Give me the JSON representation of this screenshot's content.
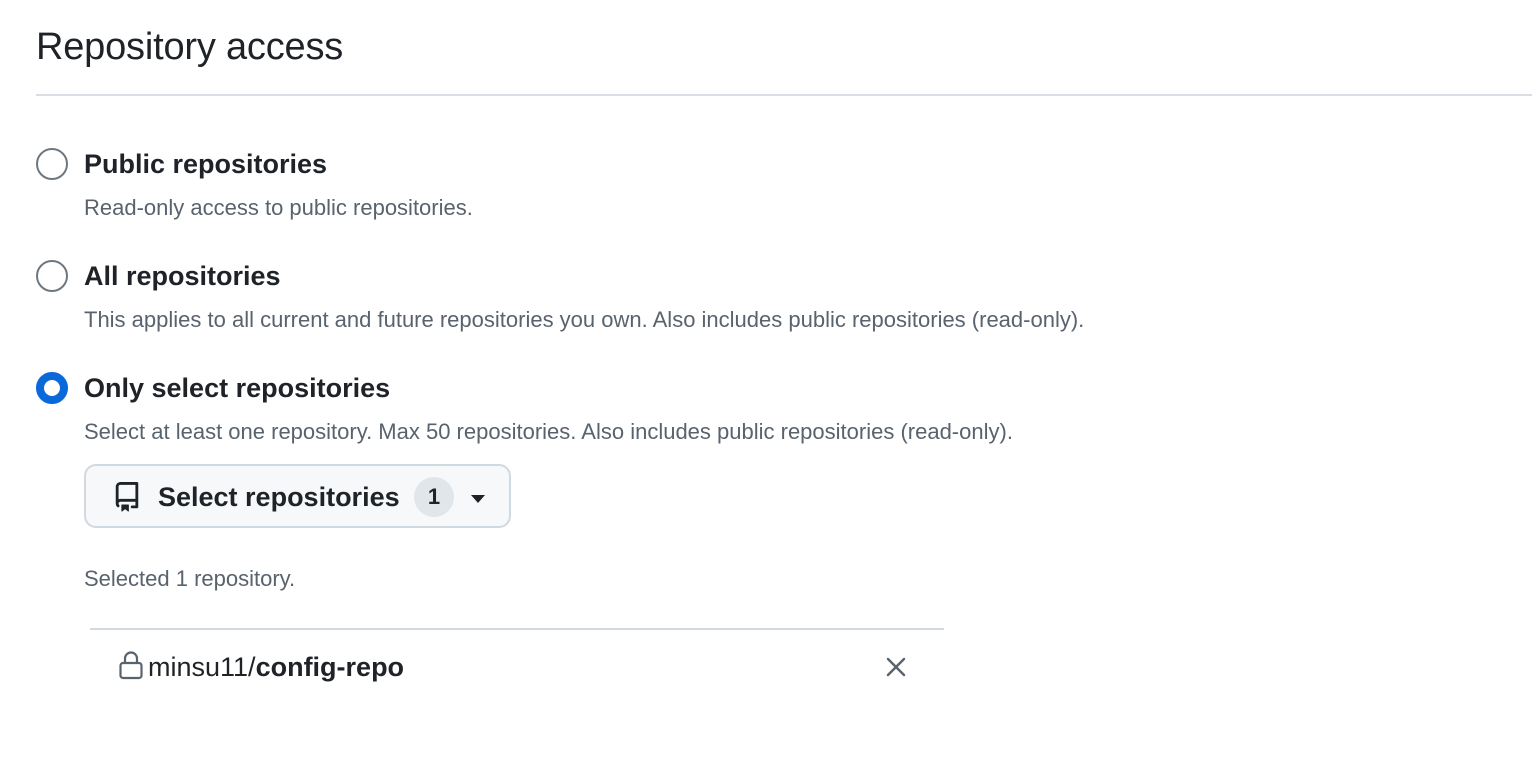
{
  "section": {
    "title": "Repository access"
  },
  "options": [
    {
      "label": "Public repositories",
      "description": "Read-only access to public repositories.",
      "checked": false
    },
    {
      "label": "All repositories",
      "description": "This applies to all current and future repositories you own. Also includes public repositories (read-only).",
      "checked": false
    },
    {
      "label": "Only select repositories",
      "description": "Select at least one repository. Max 50 repositories. Also includes public repositories (read-only).",
      "checked": true
    }
  ],
  "select_button": {
    "icon": "repo-icon",
    "label": "Select repositories",
    "count": "1",
    "caret_icon": "triangle-down-icon"
  },
  "selected_summary": "Selected 1 repository.",
  "selected_repositories": [
    {
      "icon": "lock-icon",
      "owner": "minsu11/",
      "name": "config-repo",
      "remove_icon": "x-icon"
    }
  ],
  "colors": {
    "accent": "#0969da",
    "text_primary": "#1f2328",
    "text_muted": "#59636e",
    "border": "#d1d9e0",
    "button_bg": "#f6f8fa"
  }
}
